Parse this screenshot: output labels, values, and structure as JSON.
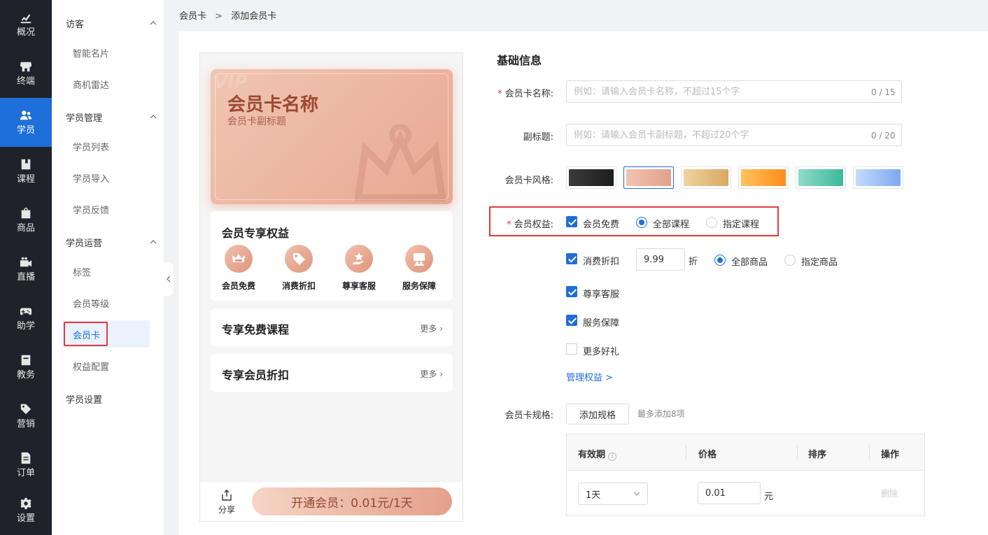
{
  "rail": {
    "items": [
      {
        "label": "概况",
        "icon": "chart-icon"
      },
      {
        "label": "终端",
        "icon": "store-icon"
      },
      {
        "label": "学员",
        "icon": "users-icon"
      },
      {
        "label": "课程",
        "icon": "book-icon"
      },
      {
        "label": "商品",
        "icon": "bag-icon"
      },
      {
        "label": "直播",
        "icon": "video-icon"
      },
      {
        "label": "助学",
        "icon": "gamepad-icon"
      },
      {
        "label": "教务",
        "icon": "calendar-icon"
      },
      {
        "label": "营销",
        "icon": "tag-icon"
      },
      {
        "label": "订单",
        "icon": "order-icon"
      },
      {
        "label": "设置",
        "icon": "gear-icon"
      }
    ],
    "active": "学员"
  },
  "sidebar": {
    "groups": [
      {
        "title": "访客",
        "items": [
          "智能名片",
          "商机雷达"
        ]
      },
      {
        "title": "学员管理",
        "items": [
          "学员列表",
          "学员导入",
          "学员反馈"
        ]
      },
      {
        "title": "学员运营",
        "items": [
          "标签",
          "会员等级",
          "会员卡",
          "权益配置"
        ]
      }
    ],
    "settings": "学员设置",
    "active_item": "会员卡"
  },
  "breadcrumb": {
    "parent": "会员卡",
    "separator": ">",
    "current": "添加会员卡"
  },
  "preview": {
    "card_watermark": "VIP",
    "card_name": "会员卡名称",
    "card_subtitle": "会员卡副标题",
    "perks_title": "会员专享权益",
    "perks": [
      {
        "label": "会员免费",
        "icon": "vip-crown-icon"
      },
      {
        "label": "消费折扣",
        "icon": "discount-tag-icon"
      },
      {
        "label": "尊享客服",
        "icon": "service-icon"
      },
      {
        "label": "服务保障",
        "icon": "guarantee-icon"
      }
    ],
    "section_free_courses": "专享免费课程",
    "section_discounts": "专享会员折扣",
    "more": "更多",
    "share": "分享",
    "join_button": "开通会员：0.01元/1天"
  },
  "form": {
    "section_title": "基础信息",
    "name_label": "会员卡名称:",
    "name_placeholder": "例如：请输入会员卡名称，不超过15个字",
    "name_count": "0 / 15",
    "subtitle_label": "副标题:",
    "subtitle_placeholder": "例如：请输入会员卡副标题，不超过20个字",
    "subtitle_count": "0 / 20",
    "style_label": "会员卡风格:",
    "styles": [
      {
        "from": "#3a3a3a",
        "to": "#1e1e1e"
      },
      {
        "from": "#f0c4b2",
        "to": "#e3a08a"
      },
      {
        "from": "#efd3a0",
        "to": "#d9a862"
      },
      {
        "from": "#ffc25c",
        "to": "#ff8c1a"
      },
      {
        "from": "#8fdcc7",
        "to": "#3bb89a"
      },
      {
        "from": "#c4dbff",
        "to": "#7ea9ef"
      }
    ],
    "selected_style": 1,
    "benefits_label": "会员权益:",
    "benefit_free": "会员免费",
    "scope_all_courses": "全部课程",
    "scope_specific_courses": "指定课程",
    "benefit_discount": "消费折扣",
    "discount_value": "9.99",
    "discount_unit": "折",
    "scope_all_goods": "全部商品",
    "scope_specific_goods": "指定商品",
    "benefit_service": "尊享客服",
    "benefit_guarantee": "服务保障",
    "benefit_gifts": "更多好礼",
    "manage_link": "管理权益 >",
    "spec_label": "会员卡规格:",
    "add_spec_button": "添加规格",
    "spec_hint": "最多添加8项",
    "table": {
      "headers": [
        "有效期",
        "价格",
        "排序",
        "操作"
      ],
      "row": {
        "period": "1天",
        "price": "0.01",
        "price_unit": "元",
        "delete": "删除"
      }
    }
  },
  "colors": {
    "primary": "#1e6fd9",
    "highlight": "#e23b3b",
    "rail_bg": "#1f2329"
  }
}
